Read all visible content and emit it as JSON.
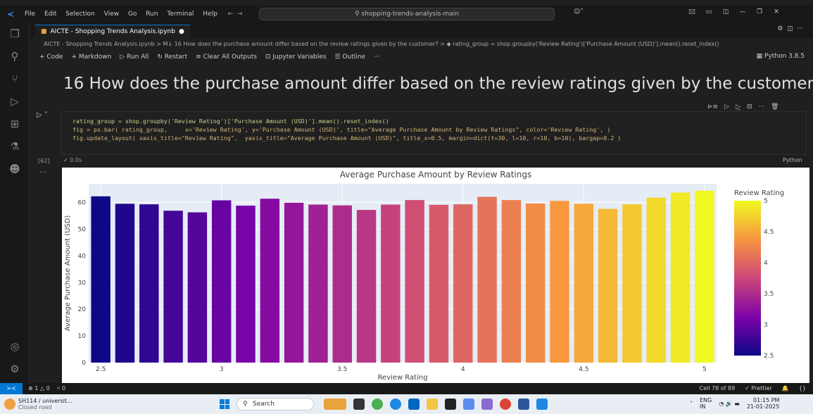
{
  "window": {
    "menu": [
      "File",
      "Edit",
      "Selection",
      "View",
      "Go",
      "Run",
      "Terminal",
      "Help"
    ],
    "search": "shopping-trends-analysis-main"
  },
  "tab": {
    "title": "AICTE - Shopping Trends Analysis.ipynb",
    "modified": "●"
  },
  "breadcrumb": "AICTE - Shopping Trends Analysis.ipynb > M↓ 16 How does the purchase amount differ based on the review ratings given by the customer? > ◆ rating_group = shop.groupby('Review Rating')['Purchase Amount (USD)'].mean().reset_index()",
  "toolbar": {
    "code": "+ Code",
    "markdown": "+ Markdown",
    "run_all": "▷ Run All",
    "restart": "↻ Restart",
    "clear": "≡ Clear All Outputs",
    "variables": "⊡ Jupyter Variables",
    "outline": "☰ Outline",
    "more": "···",
    "kernel": "Python 3.8.5"
  },
  "markdown_heading": "16 How does the purchase amount differ based on the review ratings given by the customer?",
  "code_lines": [
    "rating_group = shop.groupby('Review Rating')['Purchase Amount (USD)'].mean().reset_index()",
    "fig = px.bar( rating_group,     x='Review Rating', y='Purchase Amount (USD)', title=\"Average Purchase Amount by Review Ratings\", color='Review Rating', )",
    "fig.update_layout( xaxis_title=\"Review Rating\",  yaxis_title=\"Average Purchase Amount (USD)\", title_x=0.5, margin=dict(t=30, l=10, r=10, b=10), bargap=0.2 )"
  ],
  "exec": {
    "count": "[62]",
    "time": "0.0s",
    "language": "Python"
  },
  "chart_data": {
    "type": "bar",
    "title": "Average Purchase Amount by Review Ratings",
    "xlabel": "Review Rating",
    "ylabel": "Average Purchase Amount (USD)",
    "x": [
      2.5,
      2.6,
      2.7,
      2.8,
      2.9,
      3.0,
      3.1,
      3.2,
      3.3,
      3.4,
      3.5,
      3.6,
      3.7,
      3.8,
      3.9,
      4.0,
      4.1,
      4.2,
      4.3,
      4.4,
      4.5,
      4.6,
      4.7,
      4.8,
      4.9,
      5.0
    ],
    "values": [
      62.3,
      59.5,
      59.3,
      56.9,
      56.3,
      60.8,
      58.8,
      61.4,
      59.9,
      59.2,
      58.9,
      57.2,
      59.2,
      60.9,
      59.1,
      59.3,
      62.1,
      60.9,
      59.6,
      60.6,
      59.5,
      57.6,
      59.3,
      61.8,
      63.7,
      64.4
    ],
    "xticks": [
      "2.5",
      "3",
      "3.5",
      "4",
      "4.5",
      "5"
    ],
    "yticks": [
      0,
      10,
      20,
      30,
      40,
      50,
      60
    ],
    "ylim": [
      0,
      67
    ],
    "xlim": [
      2.45,
      5.05
    ],
    "colorbar": {
      "title": "Review Rating",
      "ticks": [
        "2.5",
        "3",
        "3.5",
        "4",
        "4.5",
        "5"
      ],
      "range": [
        2.5,
        5
      ]
    }
  },
  "status": {
    "errors": "⊗ 1 △ 0",
    "ports": "⑂ 0",
    "cell": "Cell 78 of 89",
    "prettier": "✓ Prettier"
  },
  "taskbar": {
    "weather_title": "SH114 / universit...",
    "weather_sub": "Closed road",
    "search": "Search",
    "lang": "ENG",
    "region": "IN",
    "time": "01:15 PM",
    "date": "21-01-2025"
  }
}
